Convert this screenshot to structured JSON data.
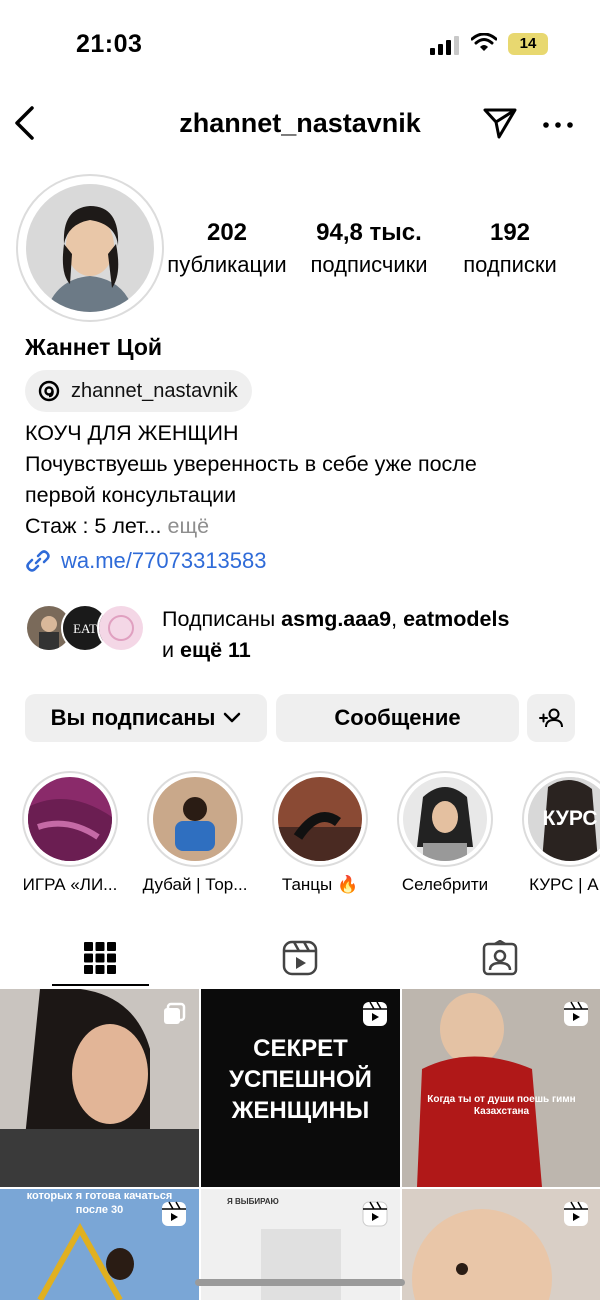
{
  "status_bar": {
    "time": "21:03",
    "battery": "14"
  },
  "header": {
    "username": "zhannet_nastavnik"
  },
  "stats": [
    {
      "value": "202",
      "label": "публикации"
    },
    {
      "value": "94,8 тыс.",
      "label": "подписчики"
    },
    {
      "value": "192",
      "label": "подписки"
    }
  ],
  "profile": {
    "name": "Жаннет Цой",
    "threads_handle": "zhannet_nastavnik",
    "bio_line1": "КОУЧ ДЛЯ ЖЕНЩИН",
    "bio_line2": "Почувствуешь уверенность в себе уже после",
    "bio_line3": "первой консультации",
    "bio_line4": "Стаж : 5 лет...",
    "bio_more": "ещё",
    "link": "wa.me/77073313583"
  },
  "mutual": {
    "prefix": "Подписаны",
    "user1": "asmg.aaa9",
    "sep": ",",
    "user2": "eatmodels",
    "and": "и",
    "more": "ещё 11"
  },
  "buttons": {
    "following": "Вы подписаны",
    "message": "Сообщение"
  },
  "highlights": [
    {
      "label": "ИГРА «ЛИ...",
      "color": "#8a2a6a"
    },
    {
      "label": "Дубай | Тор...",
      "color": "#3a6fb0"
    },
    {
      "label": "Танцы 🔥",
      "color": "#6a4030"
    },
    {
      "label": "Селебрити",
      "color": "#333333"
    },
    {
      "label": "КУРС | АН",
      "color": "#555555",
      "image_text": "КУРС"
    }
  ],
  "tabs": [
    "grid-icon",
    "reels-icon",
    "tagged-icon"
  ],
  "posts": [
    {
      "caption": "",
      "icon": "carousel-icon"
    },
    {
      "caption": "СЕКРЕТ УСПЕШНОЙ ЖЕНЩИНЫ",
      "icon": "reel-icon"
    },
    {
      "caption": "Когда ты от души поешь гимн Казахстана",
      "icon": "reel-icon"
    },
    {
      "caption": "которых я готова качаться после 30",
      "icon": "reel-icon"
    },
    {
      "caption": "Я ВЫБИРАЮ",
      "icon": "reel-icon"
    },
    {
      "caption": "",
      "icon": "reel-icon"
    }
  ],
  "colors": {
    "link": "#2f6bd8",
    "button_bg": "#efefef",
    "muted": "#8e8e8e"
  }
}
